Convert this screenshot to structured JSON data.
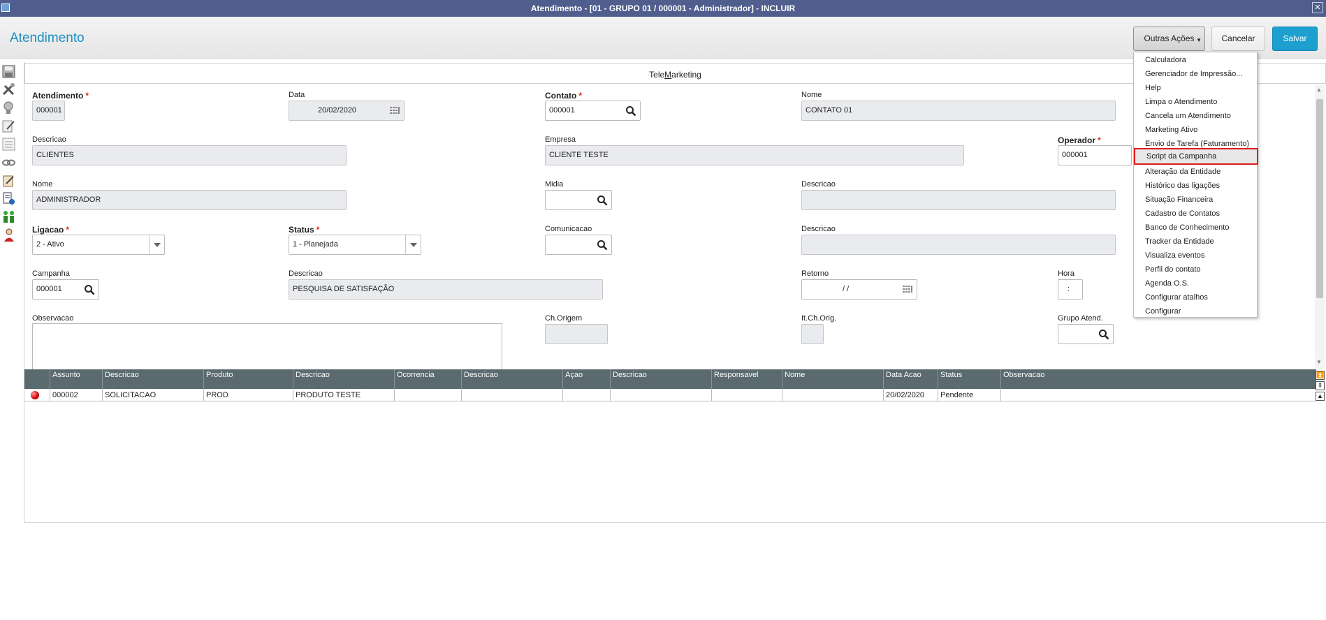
{
  "window": {
    "title": "Atendimento - [01 - GRUPO 01 / 000001 - Administrador] - INCLUIR",
    "close_glyph": "✕"
  },
  "header": {
    "page_title": "Atendimento",
    "outras_acoes_label": "Outras Ações",
    "cancelar_label": "Cancelar",
    "salvar_label": "Salvar"
  },
  "tab": {
    "label_prefix": "Tele",
    "label_underlined": "M",
    "label_suffix": "arketing"
  },
  "fields": {
    "atendimento": {
      "label": "Atendimento",
      "value": "000001",
      "required": "*"
    },
    "data": {
      "label": "Data",
      "value": "20/02/2020"
    },
    "contato": {
      "label": "Contato",
      "value": "000001",
      "required": "*"
    },
    "nome_contato": {
      "label": "Nome",
      "value": "CONTATO 01"
    },
    "descricao_cliente": {
      "label": "Descricao",
      "value": "CLIENTES"
    },
    "empresa": {
      "label": "Empresa",
      "value": "CLIENTE TESTE"
    },
    "operador": {
      "label": "Operador",
      "value": "000001",
      "required": "*"
    },
    "nome_operador": {
      "label": "Nome",
      "value": "ADMINISTRADOR"
    },
    "midia": {
      "label": "Midia",
      "value": ""
    },
    "descricao_midia": {
      "label": "Descricao",
      "value": ""
    },
    "ligacao": {
      "label": "Ligacao",
      "value": "2 - Ativo",
      "required": "*"
    },
    "status": {
      "label": "Status",
      "value": "1 - Planejada",
      "required": "*"
    },
    "comunicacao": {
      "label": "Comunicacao",
      "value": ""
    },
    "descricao_comunicacao": {
      "label": "Descricao",
      "value": ""
    },
    "campanha": {
      "label": "Campanha",
      "value": "000001"
    },
    "descricao_campanha": {
      "label": "Descricao",
      "value": "PESQUISA DE SATISFAÇÃO"
    },
    "retorno": {
      "label": "Retorno",
      "value": "/ /"
    },
    "hora": {
      "label": "Hora",
      "value": ":"
    },
    "observacao": {
      "label": "Observacao",
      "value": ""
    },
    "ch_origem": {
      "label": "Ch.Origem",
      "value": ""
    },
    "it_ch_orig": {
      "label": "It.Ch.Orig.",
      "value": ""
    },
    "grupo_atend": {
      "label": "Grupo Atend.",
      "value": ""
    }
  },
  "grid": {
    "columns": [
      "Assunto",
      "Descricao",
      "Produto",
      "Descricao",
      "Ocorrencia",
      "Descricao",
      "Açao",
      "Descricao",
      "Responsavel",
      "Nome",
      "Data Acao",
      "Status",
      "Observacao"
    ],
    "rows": [
      [
        "000002",
        "SOLICITACAO",
        "PROD",
        "PRODUTO TESTE",
        "",
        "",
        "",
        "",
        "",
        "",
        "20/02/2020",
        "Pendente",
        ""
      ]
    ]
  },
  "menu": {
    "items": [
      "Calculadora",
      "Gerenciador de Impressão...",
      "Help",
      "Limpa o Atendimento",
      "Cancela um Atendimento",
      "Marketing Ativo",
      "Envio de Tarefa (Faturamento)",
      "Script da Campanha",
      "Alteração da Entidade",
      "Histórico das ligações",
      "Situação Financeira",
      "Cadastro de Contatos",
      "Banco de Conhecimento",
      "Tracker da Entidade",
      "Visualiza eventos",
      "Perfil do contato",
      "Agenda O.S.",
      "Configurar atalhos",
      "Configurar"
    ],
    "highlighted": "Script da Campanha"
  },
  "colors": {
    "accent": "#1a8fc0",
    "save_button": "#1d9fcf",
    "titlebar": "#4f5e8d",
    "grid_header": "#5b6a6e",
    "highlight_border": "#e01c1c"
  },
  "icons": [
    "save-icon",
    "tools-icon",
    "lightbulb-icon",
    "edit-note-icon",
    "list-icon",
    "chain-icon",
    "clipboard-edit-icon",
    "document-add-icon",
    "people-icon",
    "agent-icon",
    "search-icon",
    "calendar-icon",
    "dropdown-arrow-icon",
    "status-red-icon"
  ]
}
